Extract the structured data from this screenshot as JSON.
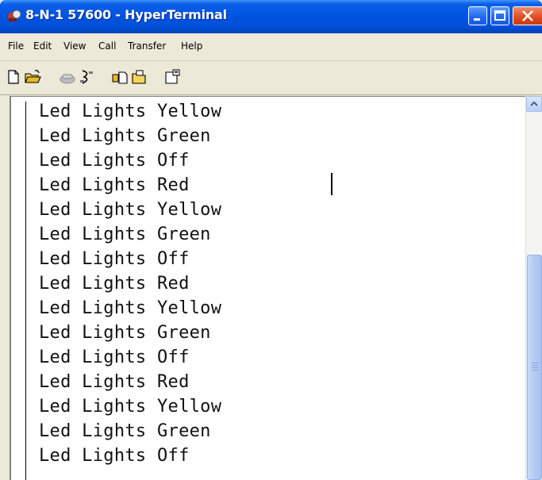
{
  "window": {
    "title": "8-N-1 57600 - HyperTerminal"
  },
  "menu": {
    "items": [
      "File",
      "Edit",
      "View",
      "Call",
      "Transfer",
      "Help"
    ]
  },
  "toolbar": {
    "icons": [
      "new-connection-icon",
      "open-icon",
      "call-icon",
      "disconnect-icon",
      "send-file-icon",
      "receive-file-icon",
      "properties-icon"
    ]
  },
  "terminal": {
    "lines": [
      "Led Lights Yellow",
      "Led Lights Green",
      "Led Lights Off",
      "Led Lights Red",
      "Led Lights Yellow",
      "Led Lights Green",
      "Led Lights Off",
      "Led Lights Red",
      "Led Lights Yellow",
      "Led Lights Green",
      "Led Lights Off",
      "Led Lights Red",
      "Led Lights Yellow",
      "Led Lights Green",
      "Led Lights Off"
    ]
  },
  "colors": {
    "titlebar": "#0054e3",
    "close_button": "#e04b20",
    "menu_background": "#ece9d8"
  }
}
